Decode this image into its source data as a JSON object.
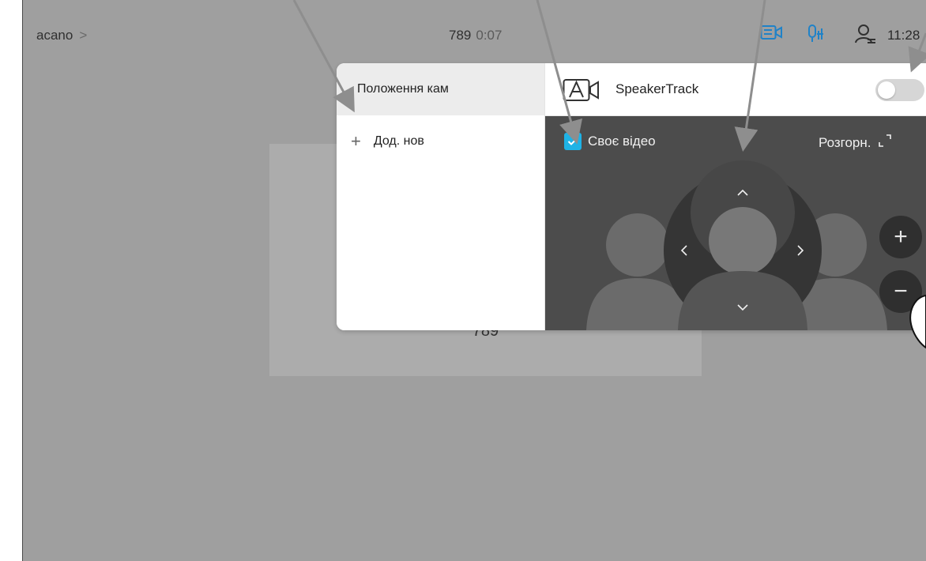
{
  "topbar": {
    "breadcrumb": "acano",
    "breadcrumb_sep": ">",
    "call_number": "789",
    "call_duration": "0:07",
    "clock": "11:28"
  },
  "call": {
    "number": "789"
  },
  "camera_panel": {
    "presets_header": "Положення кам",
    "add_new_label": "Дод. нов",
    "speakertrack_label": "SpeakerTrack",
    "speakertrack_on": false,
    "selfview_label": "Своє відео",
    "selfview_checked": true,
    "expand_label": "Розгорн.",
    "zoom_in_symbol": "+",
    "zoom_out_symbol": "−"
  },
  "icons": {
    "camera_control": "camera-control-icon",
    "mic": "microphone-icon",
    "contacts": "person-icon",
    "speakertrack": "speakertrack-camera-icon",
    "add": "plus-icon",
    "expand": "expand-icon"
  },
  "colors": {
    "accent": "#1eb3e6",
    "icon_blue": "#1f82c8",
    "camera_bg": "#4c4c4c",
    "screen_bg": "#9f9f9f"
  }
}
